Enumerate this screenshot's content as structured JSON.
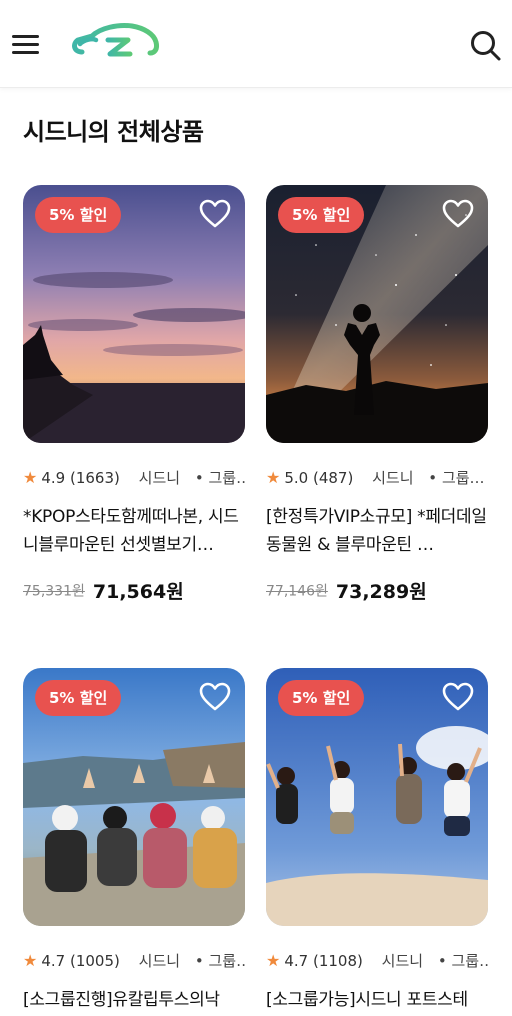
{
  "section_title": "시드니의 전체상품",
  "colors": {
    "badge": "#e8524f",
    "star": "#f08a3c",
    "logo_teal": "#3fb6a8",
    "logo_green": "#5dc977"
  },
  "icons": {
    "menu": "hamburger-menu-icon",
    "search": "search-icon",
    "heart": "heart-outline-icon",
    "star": "star-icon"
  },
  "products": [
    {
      "badge": "5% 할인",
      "rating": "4.9",
      "reviews": "(1663)",
      "city": "시드니",
      "category": "그룹…",
      "title": "*KPOP스타도함께떠나본, 시드니블루마운틴 선셋별보기…",
      "original_price": "75,331원",
      "sale_price": "71,564원"
    },
    {
      "badge": "5% 할인",
      "rating": "5.0",
      "reviews": "(487)",
      "city": "시드니",
      "category": "그룹…",
      "title": "[한정특가VIP소규모] *페더데일 동물원 & 블루마운틴 …",
      "original_price": "77,146원",
      "sale_price": "73,289원"
    },
    {
      "badge": "5% 할인",
      "rating": "4.7",
      "reviews": "(1005)",
      "city": "시드니",
      "category": "그룹…",
      "title": "[소그룹진행]유칼립투스의낙",
      "original_price": "",
      "sale_price": ""
    },
    {
      "badge": "5% 할인",
      "rating": "4.7",
      "reviews": "(1108)",
      "city": "시드니",
      "category": "그룹…",
      "title": "[소그룹가능]시드니 포트스테",
      "original_price": "",
      "sale_price": ""
    }
  ]
}
